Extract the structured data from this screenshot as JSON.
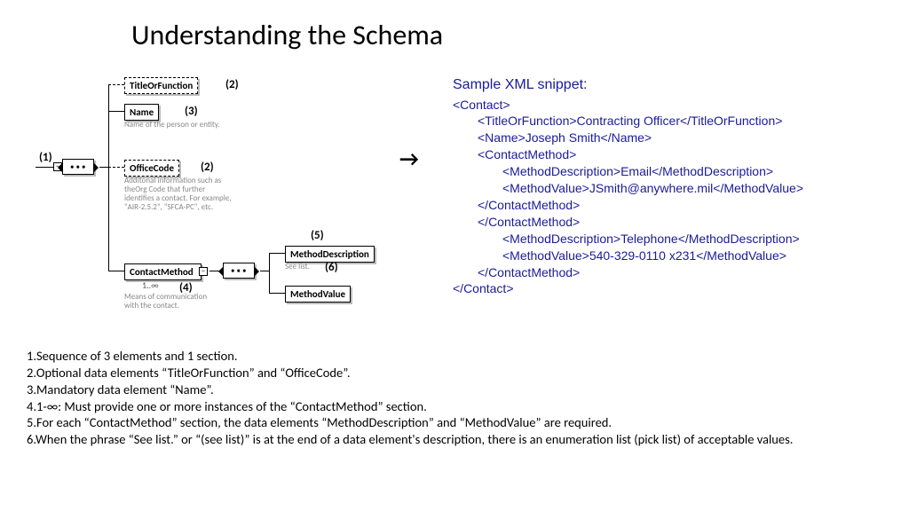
{
  "title": "Understanding the Schema",
  "diagram": {
    "nodes": {
      "titleOrFunction": "TitleOrFunction",
      "name": "Name",
      "nameDesc": "Name of the person or entity.",
      "officeCode": "OfficeCode",
      "officeDesc": "Additonal information such as theOrg Code that further identifies a contact. For example, \"AIR-2.5.2\", \"SFCA-PC\", etc.",
      "contactMethod": "ContactMethod",
      "cmCard": "1..∞",
      "cmDesc": "Means of communication with the contact.",
      "methodDescription": "MethodDescription",
      "mdDesc": "See list.",
      "methodValue": "MethodValue"
    },
    "annots": {
      "a1": "(1)",
      "a2": "(2)",
      "a3": "(3)",
      "a4": "(4)",
      "a5": "(5)",
      "a6": "(6)"
    }
  },
  "xml": {
    "header": "Sample XML snippet:",
    "l0": "<Contact>",
    "l1": "<TitleOrFunction>Contracting Officer</TitleOrFunction>",
    "l2": "<Name>Joseph Smith</Name>",
    "l3": "<ContactMethod>",
    "l4": "<MethodDescription>Email</MethodDescription>",
    "l5": "<MethodValue>JSmith@anywhere.mil</MethodValue>",
    "l6": "</ContactMethod>",
    "l7": "</ContactMethod>",
    "l8": "<MethodDescription>Telephone</MethodDescription>",
    "l9": "<MethodValue>540-329-0110 x231</MethodValue>",
    "l10": "</ContactMethod>",
    "l11": "</Contact>"
  },
  "notes": {
    "n1": "1.Sequence of 3 elements and 1 section.",
    "n2": "2.Optional data elements “TitleOrFunction” and “OfficeCode”.",
    "n3": "3.Mandatory data element “Name”.",
    "n4": "4.1-∞:  Must provide one or more instances of the “ContactMethod” section.",
    "n5": "5.For each “ContactMethod” section, the data elements “MethodDescription” and “MethodValue” are required.",
    "n6": "6.When the phrase “See list.” or “(see list)” is at the end of a data element's description, there is an enumeration list (pick list) of acceptable values."
  }
}
